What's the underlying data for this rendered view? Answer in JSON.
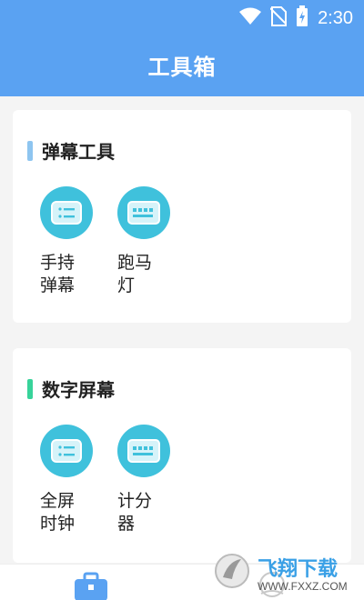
{
  "status_bar": {
    "time": "2:30",
    "icons": [
      "wifi-icon",
      "no-sim-icon",
      "battery-charging-icon"
    ]
  },
  "header": {
    "title": "工具箱",
    "color": "#5aa2f2"
  },
  "sections": [
    {
      "title": "弹幕工具",
      "accent": "#8ec5f0",
      "tools": [
        {
          "label_line1": "手持",
          "label_line2": "弹幕",
          "icon": "list-icon"
        },
        {
          "label_line1": "跑马",
          "label_line2": "灯",
          "icon": "keyboard-icon"
        }
      ]
    },
    {
      "title": "数字屏幕",
      "accent": "#37d39a",
      "tools": [
        {
          "label_line1": "全屏",
          "label_line2": "时钟",
          "icon": "list-icon"
        },
        {
          "label_line1": "计分",
          "label_line2": "器",
          "icon": "keyboard-icon"
        }
      ]
    }
  ],
  "bottom_nav": {
    "tabs": [
      {
        "icon": "toolbox-icon",
        "active": true
      },
      {
        "icon": "profile-icon",
        "active": false
      }
    ]
  },
  "watermark": {
    "text": "飞翔下载",
    "url_text": "WWW.FXXZ.COM"
  }
}
